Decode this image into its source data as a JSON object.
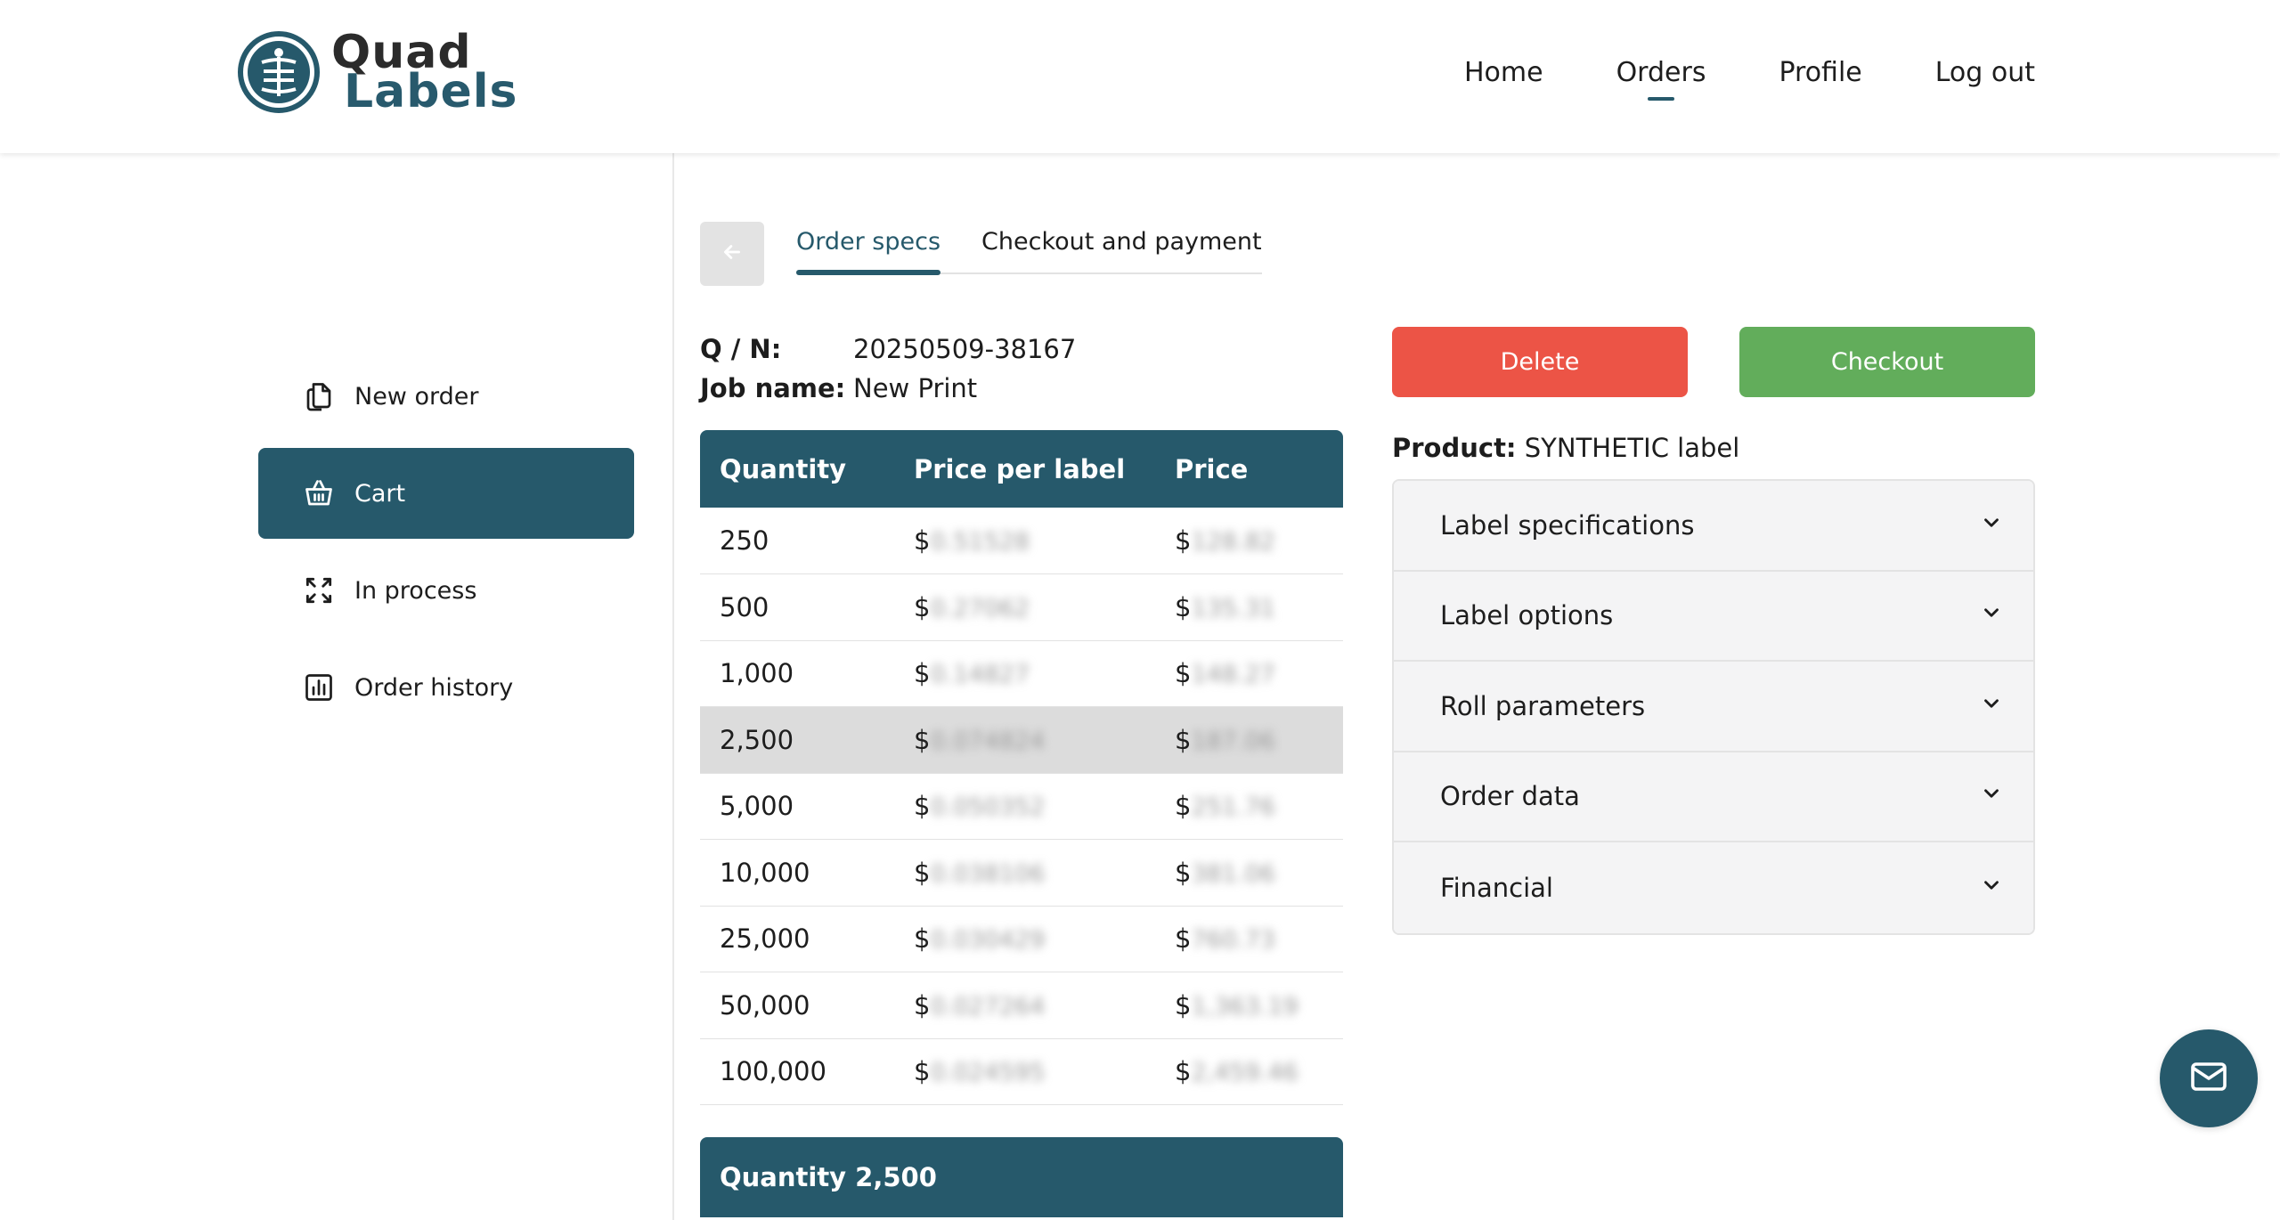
{
  "brand": {
    "line1": "Quad",
    "line2": "Labels",
    "color": "#26596b"
  },
  "nav": {
    "items": [
      {
        "label": "Home"
      },
      {
        "label": "Orders",
        "active": true
      },
      {
        "label": "Profile"
      },
      {
        "label": "Log out"
      }
    ]
  },
  "sidebar": {
    "items": [
      {
        "label": "New order",
        "icon": "copy-icon"
      },
      {
        "label": "Cart",
        "icon": "basket-icon",
        "active": true
      },
      {
        "label": "In process",
        "icon": "process-icon"
      },
      {
        "label": "Order history",
        "icon": "bar-chart-icon"
      }
    ]
  },
  "tabs": [
    {
      "label": "Order specs",
      "active": true
    },
    {
      "label": "Checkout and payment"
    }
  ],
  "order": {
    "qn_label": "Q / N:",
    "qn_value": "20250509-38167",
    "job_label": "Job name:",
    "job_value": "New Print"
  },
  "price_table": {
    "headers": [
      "Quantity",
      "Price per label",
      "Price"
    ],
    "rows": [
      {
        "quantity": "250",
        "ppl_prefix": "$",
        "ppl": "0.51528",
        "price_prefix": "$",
        "price": "128.82"
      },
      {
        "quantity": "500",
        "ppl_prefix": "$",
        "ppl": "0.27062",
        "price_prefix": "$",
        "price": "135.31"
      },
      {
        "quantity": "1,000",
        "ppl_prefix": "$",
        "ppl": "0.14827",
        "price_prefix": "$",
        "price": "148.27"
      },
      {
        "quantity": "2,500",
        "ppl_prefix": "$",
        "ppl": "0.074824",
        "price_prefix": "$",
        "price": "187.06",
        "selected": true
      },
      {
        "quantity": "5,000",
        "ppl_prefix": "$",
        "ppl": "0.050352",
        "price_prefix": "$",
        "price": "251.76"
      },
      {
        "quantity": "10,000",
        "ppl_prefix": "$",
        "ppl": "0.038106",
        "price_prefix": "$",
        "price": "381.06"
      },
      {
        "quantity": "25,000",
        "ppl_prefix": "$",
        "ppl": "0.030429",
        "price_prefix": "$",
        "price": "760.73"
      },
      {
        "quantity": "50,000",
        "ppl_prefix": "$",
        "ppl": "0.027264",
        "price_prefix": "$",
        "price": "1,363.19"
      },
      {
        "quantity": "100,000",
        "ppl_prefix": "$",
        "ppl": "0.024595",
        "price_prefix": "$",
        "price": "2,459.46"
      }
    ]
  },
  "selected_quantity": "Quantity 2,500",
  "actions": {
    "delete_label": "Delete",
    "checkout_label": "Checkout",
    "delete_color": "#ec5446",
    "checkout_color": "#62ad5b"
  },
  "product": {
    "label": "Product:",
    "value": "SYNTHETIC label"
  },
  "accordion": [
    {
      "label": "Label specifications"
    },
    {
      "label": "Label options"
    },
    {
      "label": "Roll parameters"
    },
    {
      "label": "Order data"
    },
    {
      "label": "Financial"
    }
  ],
  "fab_icon": "mail-icon"
}
